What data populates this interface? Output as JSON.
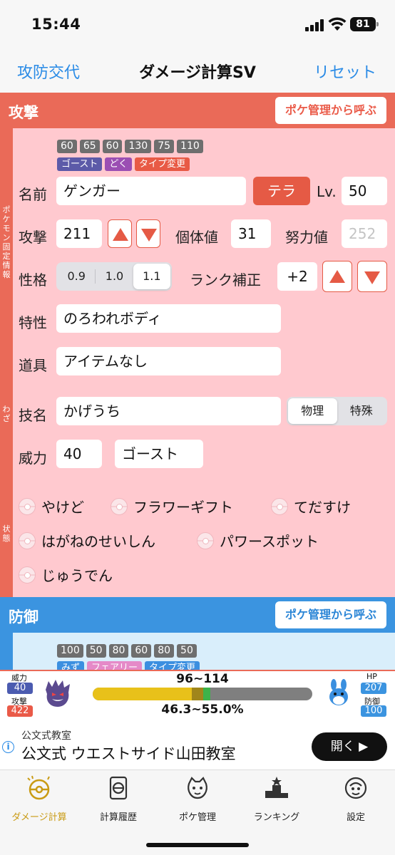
{
  "status_bar": {
    "time": "15:44",
    "battery": "81"
  },
  "nav": {
    "left": "攻防交代",
    "title": "ダメージ計算SV",
    "right": "リセット"
  },
  "attack": {
    "section_title": "攻撃",
    "call_button": "ポケ管理から呼ぶ",
    "rail_labels": {
      "fixed_info": "ポケモン固定情報",
      "move": "わざ",
      "state": "状態"
    },
    "base_stats": [
      "60",
      "65",
      "60",
      "130",
      "75",
      "110"
    ],
    "types": [
      {
        "label": "ゴースト",
        "color": "#5c5aa8"
      },
      {
        "label": "どく",
        "color": "#9b4fb3"
      },
      {
        "label": "タイプ変更",
        "color": "#e85a45"
      }
    ],
    "name_label": "名前",
    "name_value": "ゲンガー",
    "tera_button": "テラ",
    "level_label": "Lv.",
    "level_value": "50",
    "atk_label": "攻撃",
    "atk_value": "211",
    "iv_label": "個体値",
    "iv_value": "31",
    "ev_label": "努力値",
    "ev_placeholder": "252",
    "nature_label": "性格",
    "nature_options": [
      "0.9",
      "1.0",
      "1.1"
    ],
    "nature_selected": "1.1",
    "rank_label": "ランク補正",
    "rank_value": "+2",
    "ability_label": "特性",
    "ability_value": "のろわれボディ",
    "item_label": "道具",
    "item_value": "アイテムなし",
    "move_label": "技名",
    "move_value": "かげうち",
    "category_options": [
      "物理",
      "特殊"
    ],
    "category_selected": "物理",
    "power_label": "威力",
    "power_value": "40",
    "move_type": "ゴースト",
    "status_toggles": [
      "やけど",
      "フラワーギフト",
      "てだすけ",
      "はがねのせいしん",
      "パワースポット",
      "じゅうでん"
    ]
  },
  "defense": {
    "section_title": "防御",
    "call_button": "ポケ管理から呼ぶ",
    "base_stats": [
      "100",
      "50",
      "80",
      "60",
      "80",
      "50"
    ],
    "types": [
      {
        "label": "みず",
        "color": "#3b8fe0"
      },
      {
        "label": "フェアリー",
        "color": "#e58ac8"
      },
      {
        "label": "タイプ変更",
        "color": "#3b8fe0"
      }
    ]
  },
  "result": {
    "power_label": "威力",
    "power_value": "40",
    "attack_label": "攻撃",
    "attack_value": "422",
    "damage": "96~114",
    "percent": "46.3~55.0%",
    "hp_label": "HP",
    "hp_value": "207",
    "def_label": "防御",
    "def_value": "100",
    "hp_remaining_min_fraction": 0.45,
    "hp_remaining_max_fraction": 0.537
  },
  "ad": {
    "sponsor": "公文式教室",
    "title": "公文式 ウエストサイド山田教室",
    "button": "開く"
  },
  "tabs": [
    {
      "label": "ダメージ計算",
      "icon": "pokeball-calc-icon",
      "active": true
    },
    {
      "label": "計算履歴",
      "icon": "history-icon",
      "active": false
    },
    {
      "label": "ポケ管理",
      "icon": "pokemon-box-icon",
      "active": false
    },
    {
      "label": "ランキング",
      "icon": "ranking-icon",
      "active": false
    },
    {
      "label": "設定",
      "icon": "settings-icon",
      "active": false
    }
  ]
}
